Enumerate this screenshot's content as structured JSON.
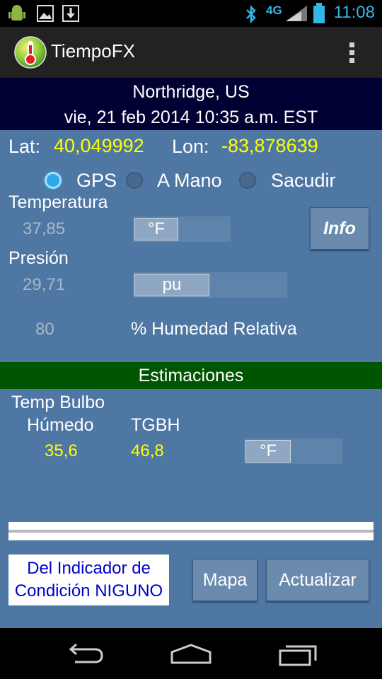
{
  "status_bar": {
    "time": "11:08",
    "network": "4G",
    "icons": [
      "android-debug-icon",
      "image-icon",
      "download-icon",
      "bluetooth-icon",
      "signal-icon",
      "battery-icon"
    ]
  },
  "app": {
    "title": "TiempoFX",
    "icon": "thermometer-icon"
  },
  "location": {
    "place": "Northridge, US",
    "datetime": "vie, 21 feb 2014 10:35 a.m. EST"
  },
  "coords": {
    "lat_label": "Lat:",
    "lat_value": "40,049992",
    "lon_label": "Lon:",
    "lon_value": "-83,878639"
  },
  "source_options": {
    "gps": "GPS",
    "manual": "A Mano",
    "shake": "Sacudir",
    "selected": "GPS"
  },
  "temperature": {
    "label": "Temperatura",
    "value": "37,85",
    "unit": "°F"
  },
  "pressure": {
    "label": "Presión",
    "value": "29,71",
    "unit": "pu"
  },
  "humidity": {
    "value": "80",
    "label": "% Humedad Relativa"
  },
  "info_button": "Info",
  "estimates": {
    "header": "Estimaciones",
    "wet_bulb_label_1": "Temp Bulbo",
    "wet_bulb_label_2": "Húmedo",
    "wet_bulb_value": "35,6",
    "wbgt_label": "TGBH",
    "wbgt_value": "46,8",
    "unit": "°F"
  },
  "indicator": {
    "line1": "Del Indicador de",
    "line2": "Condición NIGUNO"
  },
  "buttons": {
    "map": "Mapa",
    "refresh": "Actualizar"
  },
  "colors": {
    "panel": "#4e77a3",
    "header_bg": "#000033",
    "estimates_bg": "#005500",
    "value_yellow": "#ffff00",
    "accent": "#33b5e5"
  }
}
